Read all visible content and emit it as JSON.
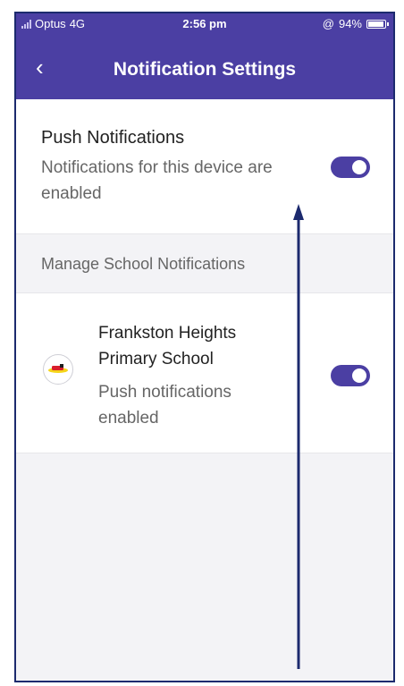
{
  "status_bar": {
    "carrier": "Optus",
    "network": "4G",
    "time": "2:56 pm",
    "battery": "94%"
  },
  "header": {
    "back_icon": "‹",
    "title": "Notification Settings"
  },
  "push": {
    "title": "Push Notifications",
    "description": "Notifications for this device are enabled",
    "enabled": true
  },
  "manage": {
    "label": "Manage School Notifications"
  },
  "school": {
    "name": "Frankston Heights Primary School",
    "status": "Push notifications enabled",
    "enabled": true
  },
  "colors": {
    "accent": "#4b3fa3",
    "annotation": "#1c2a6e"
  }
}
